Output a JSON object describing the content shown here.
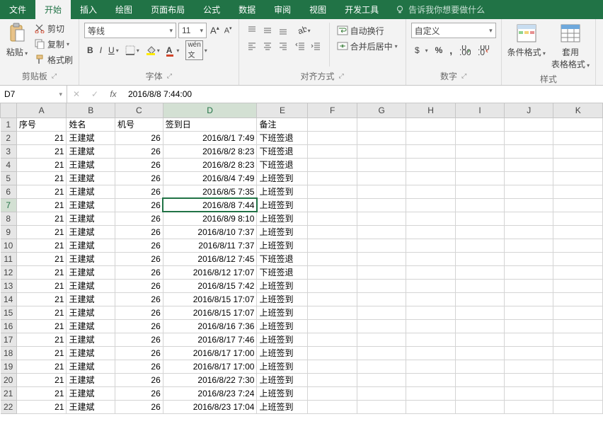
{
  "menu": {
    "file": "文件",
    "home": "开始",
    "insert": "插入",
    "draw": "绘图",
    "layout": "页面布局",
    "formulas": "公式",
    "data": "数据",
    "review": "审阅",
    "view": "视图",
    "dev": "开发工具",
    "tellme": "告诉我你想要做什么"
  },
  "ribbon": {
    "clipboard": {
      "paste": "粘贴",
      "cut": "剪切",
      "copy": "复制",
      "fmtpainter": "格式刷",
      "label": "剪贴板"
    },
    "font": {
      "name": "等线",
      "size": "11",
      "label": "字体"
    },
    "align": {
      "wrap": "自动换行",
      "merge": "合并后居中",
      "label": "对齐方式"
    },
    "number": {
      "fmt": "自定义",
      "label": "数字"
    },
    "styles": {
      "cond": "条件格式",
      "tbl": "套用",
      "tbl2": "表格格式",
      "label": "样式"
    }
  },
  "fbar": {
    "ref": "D7",
    "val": "2016/8/8  7:44:00"
  },
  "cols": [
    "",
    "A",
    "B",
    "C",
    "D",
    "E",
    "F",
    "G",
    "H",
    "I",
    "J",
    "K"
  ],
  "hdr": {
    "a": "序号",
    "b": "姓名",
    "c": "机号",
    "d": "签到日",
    "e": "备注"
  },
  "rows": [
    {
      "n": 2,
      "a": 21,
      "b": "王建斌",
      "c": 26,
      "d": "2016/8/1 7:49",
      "e": "下班签退"
    },
    {
      "n": 3,
      "a": 21,
      "b": "王建斌",
      "c": 26,
      "d": "2016/8/2 8:23",
      "e": "下班签退"
    },
    {
      "n": 4,
      "a": 21,
      "b": "王建斌",
      "c": 26,
      "d": "2016/8/2 8:23",
      "e": "下班签退"
    },
    {
      "n": 5,
      "a": 21,
      "b": "王建斌",
      "c": 26,
      "d": "2016/8/4 7:49",
      "e": "上班签到"
    },
    {
      "n": 6,
      "a": 21,
      "b": "王建斌",
      "c": 26,
      "d": "2016/8/5 7:35",
      "e": "上班签到"
    },
    {
      "n": 7,
      "a": 21,
      "b": "王建斌",
      "c": 26,
      "d": "2016/8/8 7:44",
      "e": "上班签到",
      "sel": true
    },
    {
      "n": 8,
      "a": 21,
      "b": "王建斌",
      "c": 26,
      "d": "2016/8/9 8:10",
      "e": "上班签到"
    },
    {
      "n": 9,
      "a": 21,
      "b": "王建斌",
      "c": 26,
      "d": "2016/8/10 7:37",
      "e": "上班签到"
    },
    {
      "n": 10,
      "a": 21,
      "b": "王建斌",
      "c": 26,
      "d": "2016/8/11 7:37",
      "e": "上班签到"
    },
    {
      "n": 11,
      "a": 21,
      "b": "王建斌",
      "c": 26,
      "d": "2016/8/12 7:45",
      "e": "下班签退"
    },
    {
      "n": 12,
      "a": 21,
      "b": "王建斌",
      "c": 26,
      "d": "2016/8/12 17:07",
      "e": "下班签退"
    },
    {
      "n": 13,
      "a": 21,
      "b": "王建斌",
      "c": 26,
      "d": "2016/8/15 7:42",
      "e": "上班签到"
    },
    {
      "n": 14,
      "a": 21,
      "b": "王建斌",
      "c": 26,
      "d": "2016/8/15 17:07",
      "e": "上班签到"
    },
    {
      "n": 15,
      "a": 21,
      "b": "王建斌",
      "c": 26,
      "d": "2016/8/15 17:07",
      "e": "上班签到"
    },
    {
      "n": 16,
      "a": 21,
      "b": "王建斌",
      "c": 26,
      "d": "2016/8/16 7:36",
      "e": "上班签到"
    },
    {
      "n": 17,
      "a": 21,
      "b": "王建斌",
      "c": 26,
      "d": "2016/8/17 7:46",
      "e": "上班签到"
    },
    {
      "n": 18,
      "a": 21,
      "b": "王建斌",
      "c": 26,
      "d": "2016/8/17 17:00",
      "e": "上班签到"
    },
    {
      "n": 19,
      "a": 21,
      "b": "王建斌",
      "c": 26,
      "d": "2016/8/17 17:00",
      "e": "上班签到"
    },
    {
      "n": 20,
      "a": 21,
      "b": "王建斌",
      "c": 26,
      "d": "2016/8/22 7:30",
      "e": "上班签到"
    },
    {
      "n": 21,
      "a": 21,
      "b": "王建斌",
      "c": 26,
      "d": "2016/8/23 7:24",
      "e": "上班签到"
    },
    {
      "n": 22,
      "a": 21,
      "b": "王建斌",
      "c": 26,
      "d": "2016/8/23 17:04",
      "e": "上班签到"
    }
  ]
}
